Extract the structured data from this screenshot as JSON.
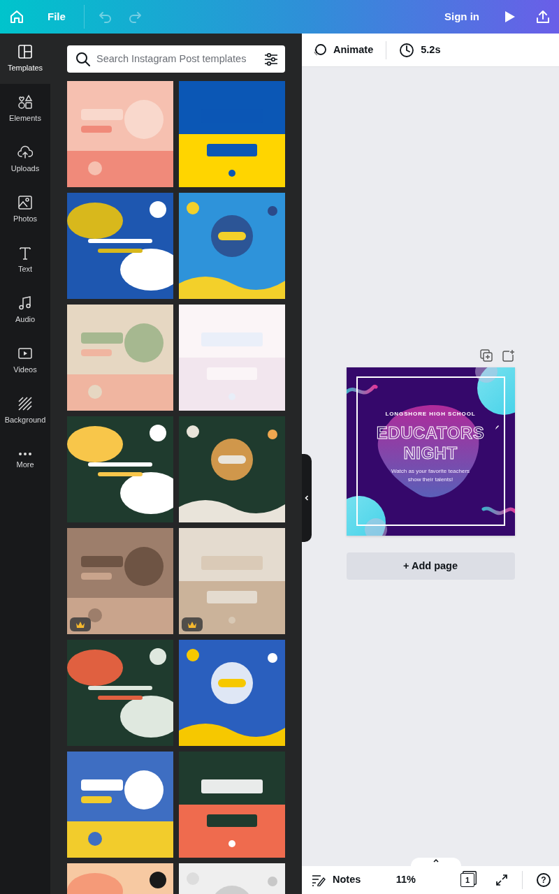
{
  "topbar": {
    "file_label": "File",
    "undo": {
      "disabled": true
    },
    "redo": {
      "disabled": true
    },
    "sign_in": "Sign in"
  },
  "sidebar": {
    "items": [
      {
        "label": "Templates",
        "selected": true
      },
      {
        "label": "Elements",
        "selected": false
      },
      {
        "label": "Uploads",
        "selected": false
      },
      {
        "label": "Photos",
        "selected": false
      },
      {
        "label": "Text",
        "selected": false
      },
      {
        "label": "Audio",
        "selected": false
      },
      {
        "label": "Videos",
        "selected": false
      },
      {
        "label": "Background",
        "selected": false
      },
      {
        "label": "More",
        "selected": false
      }
    ]
  },
  "search": {
    "placeholder": "Search Instagram Post templates"
  },
  "templates": [
    {
      "kind": "picture",
      "premium": false
    },
    {
      "kind": "picture",
      "premium": false
    },
    {
      "kind": "picture",
      "premium": false
    },
    {
      "kind": "picture",
      "premium": false
    },
    {
      "kind": "picture",
      "premium": false
    },
    {
      "kind": "picture",
      "premium": false
    },
    {
      "kind": "picture",
      "premium": false
    },
    {
      "kind": "picture",
      "premium": false
    },
    {
      "kind": "picture",
      "premium": true
    },
    {
      "kind": "picture",
      "premium": true
    },
    {
      "kind": "picture",
      "premium": false
    },
    {
      "kind": "picture",
      "premium": false
    },
    {
      "kind": "picture",
      "premium": false
    },
    {
      "kind": "picture",
      "premium": false
    },
    {
      "kind": "picture",
      "premium": false
    },
    {
      "kind": "picture",
      "premium": false
    }
  ],
  "editor_toolbar": {
    "animate": "Animate",
    "duration": "5.2s"
  },
  "design": {
    "subtitle": "LONGSHORE HIGH SCHOOL",
    "title_lines": [
      "EDUCATORS",
      "NIGHT"
    ],
    "body": "Watch as your favorite teachers show their talents!"
  },
  "add_page": "+ Add page",
  "bottom_bar": {
    "notes": "Notes",
    "zoom": "11%",
    "page_count": "1",
    "help": "?"
  }
}
